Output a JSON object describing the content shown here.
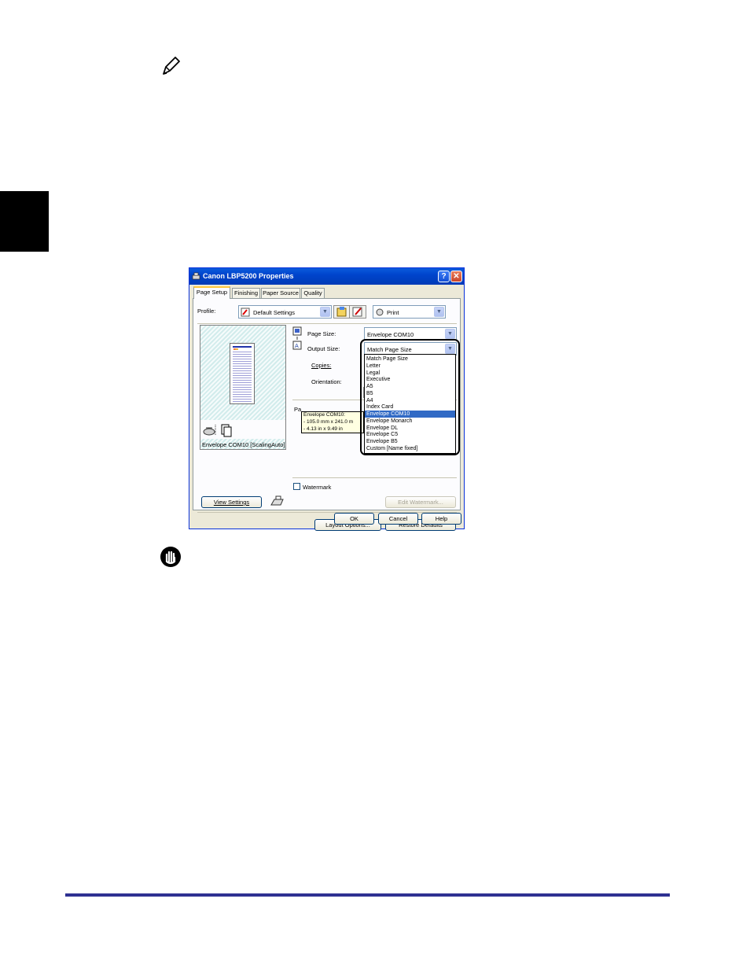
{
  "dialog": {
    "title": "Canon LBP5200 Properties",
    "tabs": [
      {
        "label": "Page Setup",
        "active": true
      },
      {
        "label": "Finishing",
        "active": false
      },
      {
        "label": "Paper Source",
        "active": false
      },
      {
        "label": "Quality",
        "active": false
      }
    ],
    "profile_label": "Profile:",
    "profile_value": "Default Settings",
    "print_value": "Print",
    "page_size_label": "Page Size:",
    "page_size_value": "Envelope COM10",
    "output_size_label": "Output Size:",
    "output_size_value": "Match Page Size",
    "copies_label": "Copies:",
    "orientation_label": "Orientation:",
    "page_layout_label": "Pa",
    "output_size_options": [
      "Match Page Size",
      "Letter",
      "Legal",
      "Executive",
      "A5",
      "B5",
      "A4",
      "Index Card",
      "Envelope COM10",
      "Envelope Monarch",
      "Envelope DL",
      "Envelope C5",
      "Envelope B5",
      "Custom [Name fixed]"
    ],
    "selected_option": "Envelope COM10",
    "tooltip_lines": [
      "Envelope COM10:",
      "- 105.0 mm x 241.0 m",
      "- 4.13 in x 9.49 in"
    ],
    "preview_caption": "Envelope COM10 [ScalingAuto]",
    "watermark_label": "Watermark",
    "watermark_checked": false,
    "view_settings_label": "View Settings",
    "edit_watermark_label": "Edit Watermark...",
    "layout_options_label": "Layout Options...",
    "restore_defaults_label": "Restore Defaults",
    "ok_label": "OK",
    "cancel_label": "Cancel",
    "help_label": "Help",
    "help_caption": "?",
    "close_caption": "✕"
  },
  "colors": {
    "titlebar": "#0044cc",
    "selection": "#316ac5",
    "rule": "#2e3192"
  }
}
